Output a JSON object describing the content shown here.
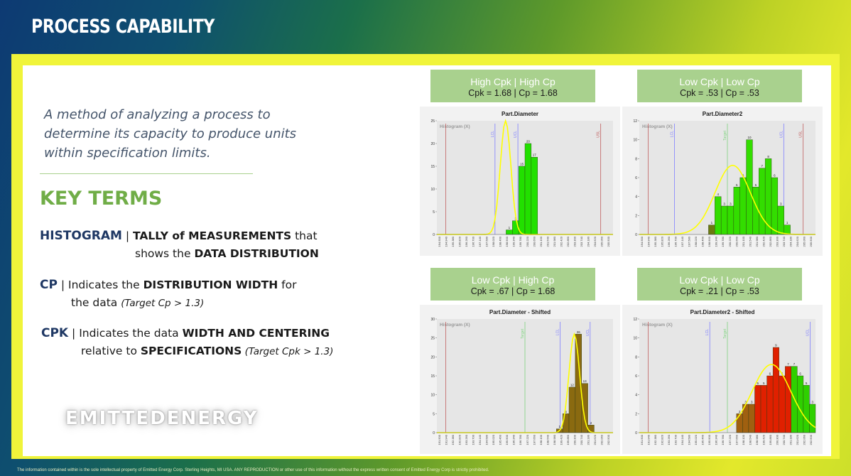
{
  "header": {
    "title": "PROCESS CAPABILITY"
  },
  "intro_text": "A method of analyzing a process to determine its capacity to produce units within specification limits.",
  "key_terms": {
    "heading": "KEY TERMS",
    "histogram": {
      "name": "HISTOGRAM",
      "sep": " | ",
      "b1": "TALLY of MEASUREMENTS",
      "t1": " that",
      "t2": "shows the ",
      "b2": "DATA DISTRIBUTION"
    },
    "cp": {
      "name": "CP",
      "sep": " | ",
      "t1": "Indicates the ",
      "b1": "DISTRIBUTION WIDTH",
      "t2": " for",
      "t3": "the data ",
      "i1": "(Target Cp > 1.3)"
    },
    "cpk": {
      "name": "CPK",
      "sep": " | ",
      "t1": "Indicates the data ",
      "b1": "WIDTH AND CENTERING",
      "t2": "relative to ",
      "b2": "SPECIFICATIONS",
      "i1": " (Target Cpk > 1.3)"
    }
  },
  "logo_text": "EMITTEDENERGY",
  "disclaimer": "The information contained within is the sole intellectual property of Emitted Energy Corp. Sterling Heights, MI USA. ANY REPRODUCTION or other use of this information without the express written consent of Emitted Energy Corp is strictly prohibited.",
  "colors": {
    "label_bg": "#a9d18e",
    "title_green": "#70ad47",
    "navy": "#1f3864",
    "fit_curve": "#ffff00"
  },
  "chart_data": [
    {
      "type": "bar",
      "label_top": "High Cpk | High Cp",
      "label_bottom": "Cpk = 1.68  |  Cp = 1.68",
      "title": "Part.Diameter",
      "legend": "Histogram (X)",
      "ylim": [
        0,
        25
      ],
      "yticks": [
        0,
        5,
        10,
        15,
        20,
        25
      ],
      "bins": 28,
      "values": [
        0,
        0,
        0,
        0,
        0,
        0,
        0,
        0,
        0,
        0,
        0,
        1,
        3,
        15,
        20,
        17,
        0,
        0,
        0,
        0,
        0,
        0,
        0,
        0,
        0,
        0,
        0,
        0
      ],
      "bar_labels": [
        "",
        "",
        "",
        "",
        "",
        "",
        "",
        "",
        "",
        "",
        "",
        "1",
        "3",
        "15",
        "20",
        "17",
        "",
        "",
        "",
        "",
        "",
        "",
        "",
        "",
        "",
        "",
        "",
        ""
      ],
      "bar_colors": [
        "#22e000"
      ],
      "lines": [
        {
          "label": "LCL",
          "pos": 0.33,
          "color": "#7f7fff"
        },
        {
          "label": "UCL",
          "pos": 0.46,
          "color": "#7f7fff"
        },
        {
          "label": "USL",
          "pos": 0.93,
          "color": "#c06060"
        }
      ],
      "lsl_pos": 0.05,
      "curve": {
        "mean": 0.39,
        "sd": 0.03,
        "peak": 25
      },
      "x_tick_labels": [
        "194.500",
        "194.940",
        "195.380",
        "195.820",
        "196.260",
        "196.700",
        "197.140",
        "197.580",
        "198.020",
        "198.460",
        "198.900",
        "199.340",
        "199.780",
        "200.220",
        "200.660",
        "201.100",
        "201.540",
        "201.980",
        "202.420",
        "202.860",
        "203.300",
        "203.740",
        "204.180",
        "204.620",
        "205.060",
        "205.500"
      ]
    },
    {
      "type": "bar",
      "label_top": "Low Cpk | Low Cp",
      "label_bottom": "Cpk = .53  |  Cp = .53",
      "title": "Part.Diameter2",
      "legend": "Histogram (X)",
      "ylim": [
        0,
        12
      ],
      "yticks": [
        0,
        2,
        4,
        6,
        8,
        10,
        12
      ],
      "bins": 28,
      "values": [
        0,
        0,
        0,
        0,
        0,
        0,
        0,
        0,
        0,
        0,
        0,
        1,
        4,
        3,
        3,
        5,
        6,
        10,
        5,
        7,
        8,
        6,
        3,
        1,
        0,
        0,
        0,
        0
      ],
      "bar_labels": [
        "",
        "",
        "",
        "",
        "",
        "",
        "",
        "",
        "",
        "",
        "",
        "1",
        "4",
        "3",
        "3",
        "5",
        "6",
        "10",
        "5",
        "7",
        "8",
        "6",
        "3",
        "1",
        "",
        "",
        "",
        ""
      ],
      "bar_colors": [
        "#6b7a10",
        "#33dd00"
      ],
      "lines": [
        {
          "label": "LCL",
          "pos": 0.2,
          "color": "#7f7fff"
        },
        {
          "label": "Target",
          "pos": 0.5,
          "color": "#7fd47f"
        },
        {
          "label": "UCL",
          "pos": 0.82,
          "color": "#7f7fff"
        },
        {
          "label": "USL",
          "pos": 0.93,
          "color": "#c06060"
        }
      ],
      "lsl_pos": 0.05,
      "curve": {
        "mean": 0.53,
        "sd": 0.1,
        "peak": 7.3
      },
      "x_tick_labels": [
        "194.500",
        "194.940",
        "195.380",
        "195.820",
        "196.260",
        "196.700",
        "197.140",
        "197.580",
        "198.020",
        "198.460",
        "198.900",
        "199.340",
        "199.780",
        "200.220",
        "200.660",
        "201.100",
        "201.540",
        "201.980",
        "202.420",
        "202.860",
        "203.300",
        "203.740",
        "204.180",
        "204.620",
        "205.060",
        "205.500"
      ]
    },
    {
      "type": "bar",
      "label_top": "Low Cpk | High Cp",
      "label_bottom": "Cpk = .67  |  Cp = 1.68",
      "title": "Part.Diameter - Shifted",
      "legend": "Histogram (X)",
      "ylim": [
        0,
        30
      ],
      "yticks": [
        0,
        5,
        10,
        15,
        20,
        25,
        30
      ],
      "bins": 28,
      "values": [
        0,
        0,
        0,
        0,
        0,
        0,
        0,
        0,
        0,
        0,
        0,
        0,
        0,
        0,
        0,
        0,
        0,
        0,
        0,
        1,
        5,
        12,
        26,
        13,
        2,
        0,
        0,
        0
      ],
      "bar_labels": [
        "",
        "",
        "",
        "",
        "",
        "",
        "",
        "",
        "",
        "",
        "",
        "",
        "",
        "",
        "",
        "",
        "",
        "",
        "",
        "1",
        "5",
        "12",
        "26",
        "13",
        "2",
        "",
        "",
        ""
      ],
      "bar_colors": [
        "#8a6a10"
      ],
      "lines": [
        {
          "label": "Target",
          "pos": 0.5,
          "color": "#7fd47f"
        },
        {
          "label": "LCL",
          "pos": 0.7,
          "color": "#7f7fff"
        },
        {
          "label": "UCL",
          "pos": 0.87,
          "color": "#7f7fff"
        }
      ],
      "lsl_pos": 0.05,
      "curve": {
        "mean": 0.78,
        "sd": 0.03,
        "peak": 26
      },
      "x_tick_labels": [
        "191.500",
        "191.940",
        "192.380",
        "192.820",
        "193.260",
        "193.700",
        "194.140",
        "194.580",
        "195.020",
        "195.460",
        "195.900",
        "196.340",
        "196.780",
        "197.220",
        "197.660",
        "198.100",
        "198.540",
        "198.980",
        "199.420",
        "199.860",
        "200.300",
        "200.740",
        "201.180",
        "201.620",
        "202.060",
        "202.500"
      ]
    },
    {
      "type": "bar",
      "label_top": "Low Cpk | Low Cp",
      "label_bottom": "Cpk = .21  |  Cp = .53",
      "title": "Part.Diameter2 - Shifted",
      "legend": "Histogram (X)",
      "ylim": [
        0,
        12
      ],
      "yticks": [
        0,
        2,
        4,
        6,
        8,
        10,
        12
      ],
      "bins": 28,
      "values": [
        0,
        0,
        0,
        0,
        0,
        0,
        0,
        0,
        0,
        0,
        0,
        0,
        0,
        0,
        0,
        0,
        2,
        3,
        3,
        5,
        5,
        6,
        9,
        6,
        7,
        7,
        6,
        5,
        3
      ],
      "bar_labels": [
        "",
        "",
        "",
        "",
        "",
        "",
        "",
        "",
        "",
        "",
        "",
        "",
        "",
        "",
        "",
        "",
        "2",
        "3",
        "3",
        "5",
        "5",
        "6",
        "9",
        "6",
        "7",
        "7",
        "6",
        "5",
        "3"
      ],
      "bar_colors": [
        "#2fd000",
        "#7aa010",
        "#a06010",
        "#e02000"
      ],
      "lines": [
        {
          "label": "LCL",
          "pos": 0.4,
          "color": "#7f7fff"
        },
        {
          "label": "Target",
          "pos": 0.5,
          "color": "#7fd47f"
        },
        {
          "label": "UCL",
          "pos": 0.97,
          "color": "#7f7fff"
        }
      ],
      "lsl_pos": 0.05,
      "curve": {
        "mean": 0.75,
        "sd": 0.11,
        "peak": 7.2
      },
      "x_tick_labels": [
        "191.500",
        "191.940",
        "192.380",
        "192.820",
        "193.260",
        "193.700",
        "194.140",
        "194.580",
        "195.020",
        "195.460",
        "195.900",
        "196.340",
        "196.780",
        "197.220",
        "197.660",
        "198.100",
        "198.540",
        "198.980",
        "199.420",
        "199.860",
        "200.300",
        "200.740",
        "201.180",
        "201.620",
        "202.060",
        "202.500"
      ]
    }
  ]
}
